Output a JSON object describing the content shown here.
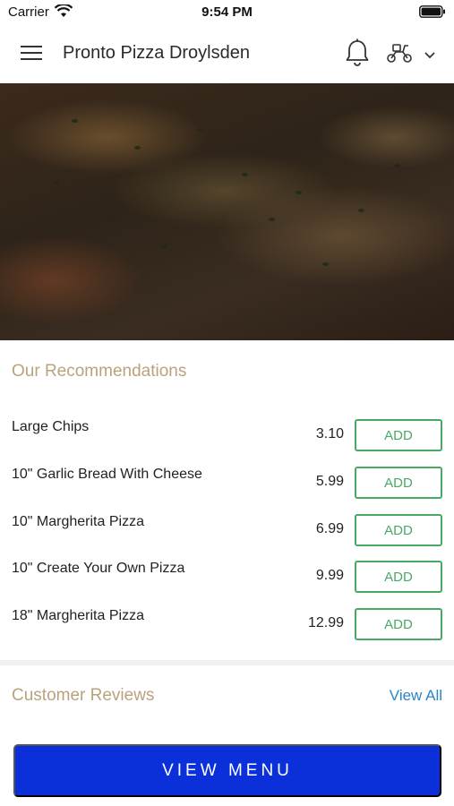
{
  "status_bar": {
    "carrier": "Carrier",
    "time": "9:54 PM"
  },
  "header": {
    "title": "Pronto Pizza Droylsden"
  },
  "recommendations": {
    "title": "Our Recommendations",
    "items": [
      {
        "name": "Large Chips",
        "price": "3.10",
        "add_label": "ADD"
      },
      {
        "name": "10\" Garlic Bread With Cheese",
        "price": "5.99",
        "add_label": "ADD"
      },
      {
        "name": "10\" Margherita Pizza",
        "price": "6.99",
        "add_label": "ADD"
      },
      {
        "name": "10\" Create Your Own Pizza",
        "price": "9.99",
        "add_label": "ADD"
      },
      {
        "name": "18\" Margherita Pizza",
        "price": "12.99",
        "add_label": "ADD"
      }
    ]
  },
  "reviews": {
    "title": "Customer Reviews",
    "view_all_label": "View All"
  },
  "footer": {
    "view_menu_label": "VIEW MENU"
  },
  "colors": {
    "accent_gold": "#b8a37d",
    "add_green": "#4aa865",
    "link_blue": "#2a86c6",
    "primary_blue": "#0b2fd8"
  },
  "icons": [
    "wifi-icon",
    "battery-icon",
    "menu-icon",
    "bell-icon",
    "scooter-icon",
    "chevron-down-icon"
  ]
}
